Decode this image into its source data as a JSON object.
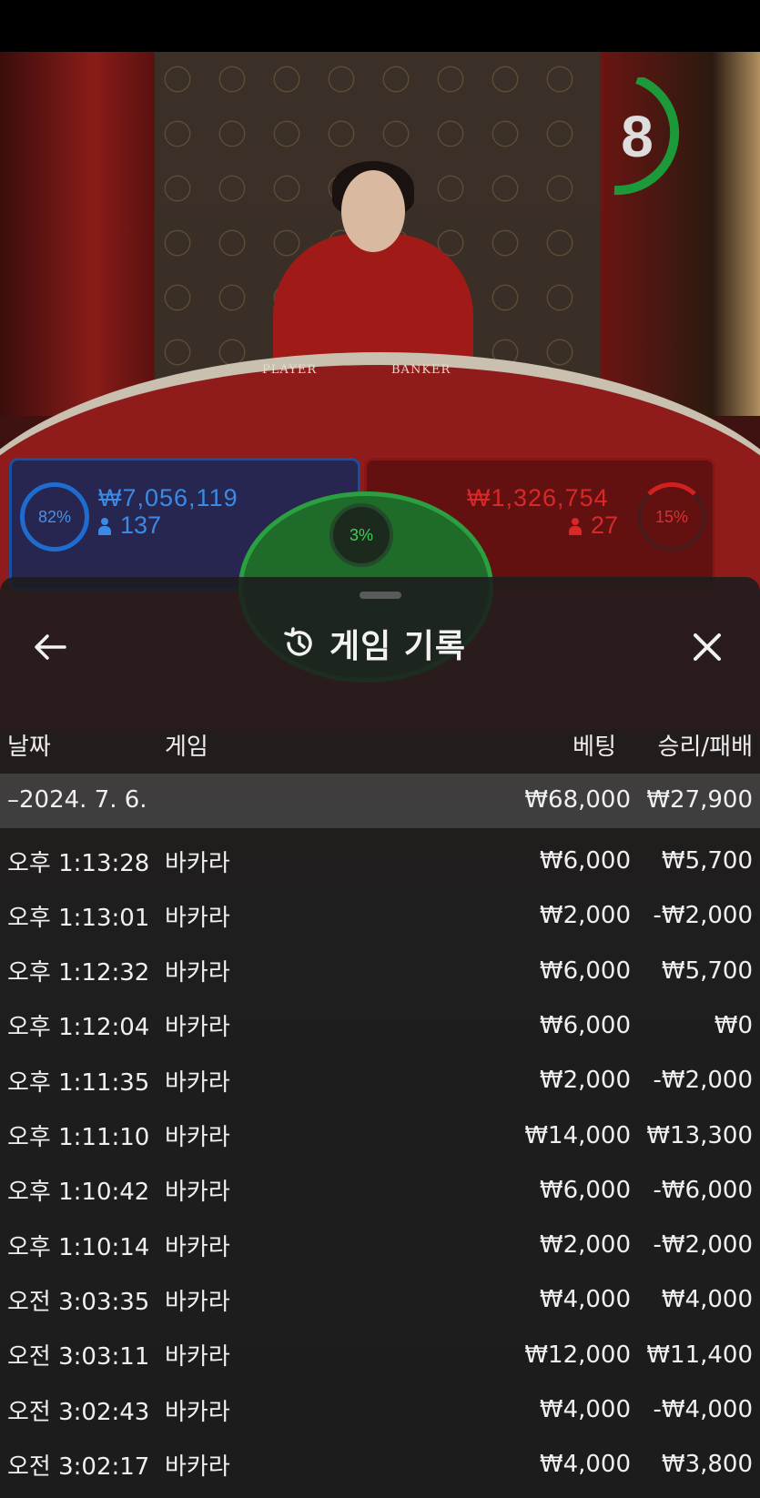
{
  "stream": {
    "countdown": "8",
    "table_labels": {
      "player": "PLAYER",
      "banker": "BANKER"
    }
  },
  "bets": {
    "player": {
      "percent": "82%",
      "amount": "₩7,056,119",
      "count": "137",
      "color": "#1f6cd0"
    },
    "banker": {
      "percent": "15%",
      "amount": "₩1,326,754",
      "count": "27",
      "color": "#d02020"
    },
    "tie": {
      "percent": "3%",
      "color": "#2aa040"
    }
  },
  "history": {
    "title": "게임 기록",
    "columns": {
      "date": "날짜",
      "game": "게임",
      "bet": "베팅",
      "result": "승리/패배"
    },
    "date_group": {
      "label": "–2024. 7. 6.",
      "total_bet": "₩68,000",
      "total_result": "₩27,900"
    },
    "rows": [
      {
        "time": "오후 1:13:28",
        "game": "바카라",
        "bet": "₩6,000",
        "result": "₩5,700"
      },
      {
        "time": "오후 1:13:01",
        "game": "바카라",
        "bet": "₩2,000",
        "result": "-₩2,000"
      },
      {
        "time": "오후 1:12:32",
        "game": "바카라",
        "bet": "₩6,000",
        "result": "₩5,700"
      },
      {
        "time": "오후 1:12:04",
        "game": "바카라",
        "bet": "₩6,000",
        "result": "₩0"
      },
      {
        "time": "오후 1:11:35",
        "game": "바카라",
        "bet": "₩2,000",
        "result": "-₩2,000"
      },
      {
        "time": "오후 1:11:10",
        "game": "바카라",
        "bet": "₩14,000",
        "result": "₩13,300"
      },
      {
        "time": "오후 1:10:42",
        "game": "바카라",
        "bet": "₩6,000",
        "result": "-₩6,000"
      },
      {
        "time": "오후 1:10:14",
        "game": "바카라",
        "bet": "₩2,000",
        "result": "-₩2,000"
      },
      {
        "time": "오전 3:03:35",
        "game": "바카라",
        "bet": "₩4,000",
        "result": "₩4,000"
      },
      {
        "time": "오전 3:03:11",
        "game": "바카라",
        "bet": "₩12,000",
        "result": "₩11,400"
      },
      {
        "time": "오전 3:02:43",
        "game": "바카라",
        "bet": "₩4,000",
        "result": "-₩4,000"
      },
      {
        "time": "오전 3:02:17",
        "game": "바카라",
        "bet": "₩4,000",
        "result": "₩3,800"
      }
    ]
  },
  "icons": {
    "back": "arrow-left-icon",
    "history": "history-clock-icon",
    "close": "close-icon"
  }
}
